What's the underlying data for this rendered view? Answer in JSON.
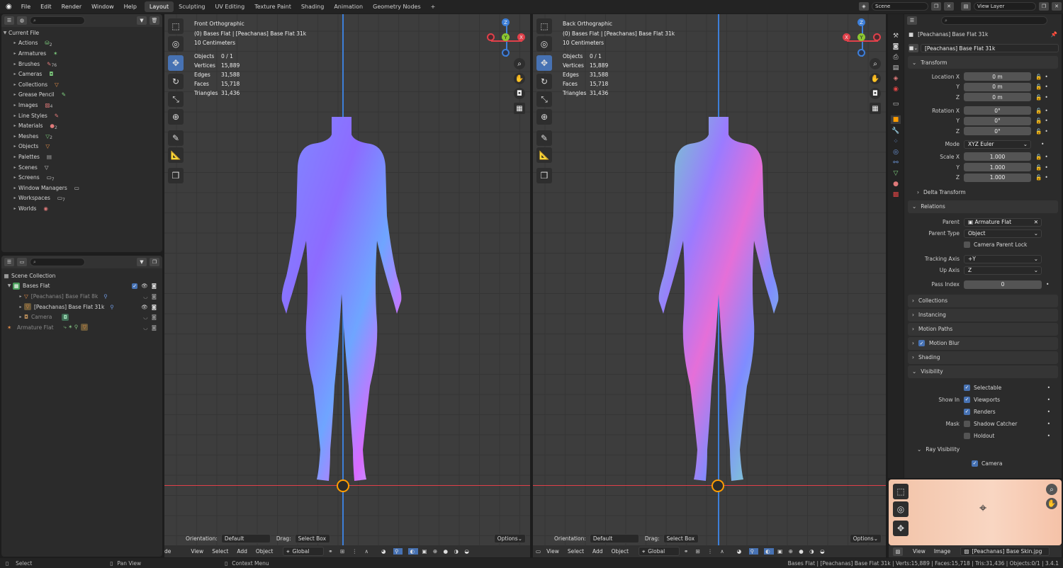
{
  "topbar": {
    "menus": [
      "File",
      "Edit",
      "Render",
      "Window",
      "Help"
    ],
    "workspaces": [
      "Layout",
      "Sculpting",
      "UV Editing",
      "Texture Paint",
      "Shading",
      "Animation",
      "Geometry Nodes"
    ],
    "active_workspace": "Layout",
    "add_tab": "+",
    "scene": "Scene",
    "view_layer": "View Layer"
  },
  "datablocks": {
    "root": "Current File",
    "items": [
      {
        "label": "Actions",
        "count": "2"
      },
      {
        "label": "Armatures",
        "count": ""
      },
      {
        "label": "Brushes",
        "count": "76"
      },
      {
        "label": "Cameras",
        "count": ""
      },
      {
        "label": "Collections",
        "count": ""
      },
      {
        "label": "Grease Pencil",
        "count": ""
      },
      {
        "label": "Images",
        "count": "4"
      },
      {
        "label": "Line Styles",
        "count": ""
      },
      {
        "label": "Materials",
        "count": "2"
      },
      {
        "label": "Meshes",
        "count": "2"
      },
      {
        "label": "Objects",
        "count": ""
      },
      {
        "label": "Palettes",
        "count": ""
      },
      {
        "label": "Scenes",
        "count": ""
      },
      {
        "label": "Screens",
        "count": "7"
      },
      {
        "label": "Window Managers",
        "count": ""
      },
      {
        "label": "Workspaces",
        "count": "7"
      },
      {
        "label": "Worlds",
        "count": ""
      }
    ]
  },
  "outliner": {
    "scene_collection": "Scene Collection",
    "items": [
      {
        "label": "Bases Flat",
        "indent": 1
      },
      {
        "label": "[Peachanas] Base Flat 8k",
        "indent": 2
      },
      {
        "label": "[Peachanas] Base Flat 31k",
        "indent": 2
      },
      {
        "label": "Camera",
        "indent": 2
      },
      {
        "label": "Armature Flat",
        "indent": 1
      }
    ]
  },
  "viewport_left": {
    "title": "Front Orthographic",
    "object": "(0) Bases Flat | [Peachanas] Base Flat 31k",
    "scale": "10 Centimeters",
    "stats": [
      [
        "Objects",
        "0 / 1"
      ],
      [
        "Vertices",
        "15,889"
      ],
      [
        "Edges",
        "31,588"
      ],
      [
        "Faces",
        "15,718"
      ],
      [
        "Triangles",
        "31,436"
      ]
    ],
    "orientation_label": "Orientation:",
    "orientation": "Default",
    "drag_label": "Drag:",
    "drag": "Select Box",
    "options": "Options",
    "menu": [
      "de",
      "View",
      "Select",
      "Add",
      "Object"
    ],
    "transform": "Global"
  },
  "viewport_right": {
    "title": "Back Orthographic",
    "object": "(0) Bases Flat | [Peachanas] Base Flat 31k",
    "scale": "10 Centimeters",
    "stats": [
      [
        "Objects",
        "0 / 1"
      ],
      [
        "Vertices",
        "15,889"
      ],
      [
        "Edges",
        "31,588"
      ],
      [
        "Faces",
        "15,718"
      ],
      [
        "Triangles",
        "31,436"
      ]
    ],
    "orientation_label": "Orientation:",
    "orientation": "Default",
    "drag_label": "Drag:",
    "drag": "Select Box",
    "options": "Options",
    "menu": [
      "View",
      "Select",
      "Add",
      "Object"
    ],
    "transform": "Global"
  },
  "gizmo_labels": {
    "z": "Z",
    "y": "Y",
    "x": "X"
  },
  "properties": {
    "object_name": "[Peachanas] Base Flat 31k",
    "data_name": "[Peachanas] Base Flat 31k",
    "transform": "Transform",
    "location_label": "Location X",
    "location": [
      "0 m",
      "0 m",
      "0 m"
    ],
    "rotation_label": "Rotation X",
    "rotation": [
      "0°",
      "0°",
      "0°"
    ],
    "axis_y": "Y",
    "axis_z": "Z",
    "mode_label": "Mode",
    "mode": "XYZ Euler",
    "scale_label": "Scale X",
    "scale": [
      "1.000",
      "1.000",
      "1.000"
    ],
    "delta_transform": "Delta Transform",
    "relations": "Relations",
    "parent_label": "Parent",
    "parent": "Armature Flat",
    "parent_type_label": "Parent Type",
    "parent_type": "Object",
    "camera_parent_lock": "Camera Parent Lock",
    "tracking_axis_label": "Tracking Axis",
    "tracking_axis": "+Y",
    "up_axis_label": "Up Axis",
    "up_axis": "Z",
    "pass_index_label": "Pass Index",
    "pass_index": "0",
    "collections": "Collections",
    "instancing": "Instancing",
    "motion_paths": "Motion Paths",
    "motion_blur": "Motion Blur",
    "shading": "Shading",
    "visibility": "Visibility",
    "selectable": "Selectable",
    "show_in_label": "Show In",
    "viewports": "Viewports",
    "renders": "Renders",
    "mask_label": "Mask",
    "shadow_catcher": "Shadow Catcher",
    "holdout": "Holdout",
    "ray_visibility": "Ray Visibility",
    "camera": "Camera"
  },
  "image_editor": {
    "menu": [
      "View",
      "Image"
    ],
    "image": "[Peachanas] Base Skin.jpg"
  },
  "statusbar": {
    "select": "Select",
    "pan": "Pan View",
    "context": "Context Menu",
    "info": "Bases Flat | [Peachanas] Base Flat 31k | Verts:15,889 | Faces:15,718 | Tris:31,436 | Objects:0/1 | 3.4.1"
  },
  "colors": {
    "accent": "#4772b3",
    "x_axis": "#e0404a",
    "y_axis": "#8cc730",
    "z_axis": "#3d7fd9",
    "origin": "#ff9d00"
  }
}
